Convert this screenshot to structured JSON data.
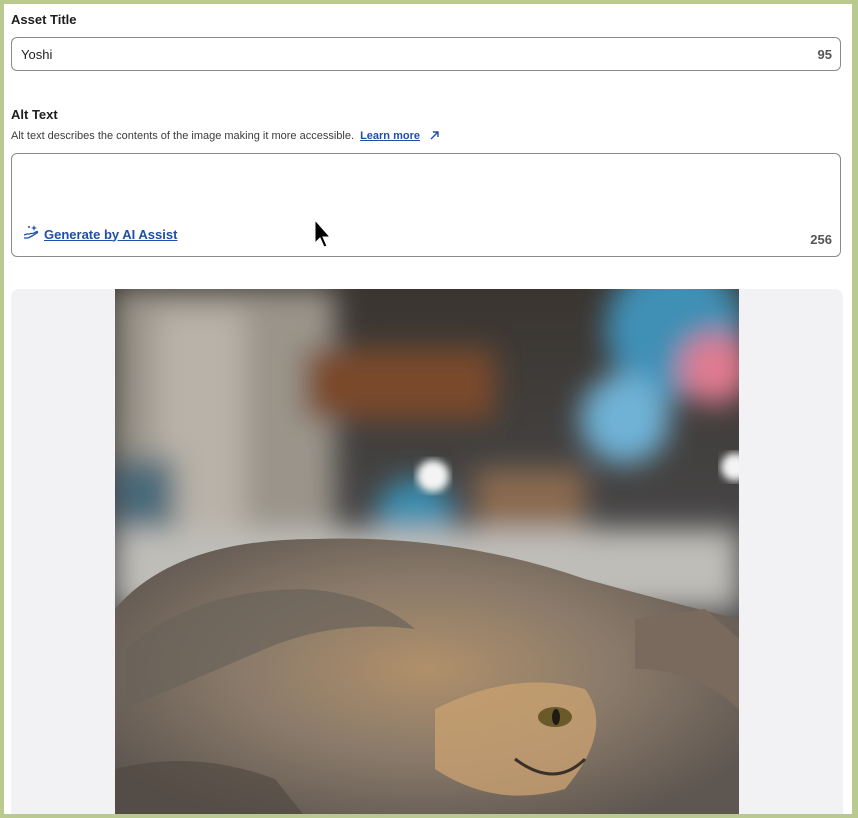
{
  "asset_title": {
    "label": "Asset Title",
    "value": "Yoshi",
    "counter": "95"
  },
  "alt_text": {
    "label": "Alt Text",
    "help": "Alt text describes the contents of the image making it more accessible.",
    "learn_more": "Learn more",
    "value": "",
    "ai_assist_label": "Generate by AI Assist",
    "counter": "256"
  },
  "icons": [
    "external-link-icon",
    "ai-assist-hand-icon",
    "mouse-cursor-icon"
  ],
  "colors": {
    "link": "#1f4fa8",
    "frame": "#b9c98f",
    "preview_bg": "#f2f2f5"
  }
}
